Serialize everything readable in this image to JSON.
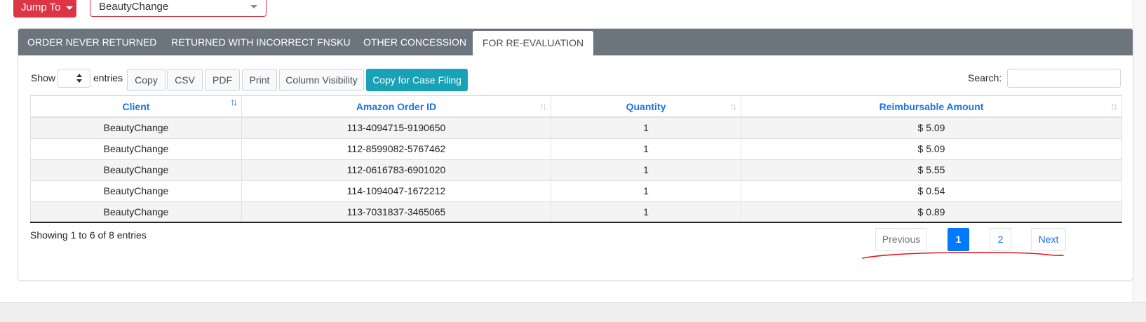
{
  "top": {
    "jump_label": "Jump To",
    "client_value": "BeautyChange"
  },
  "tabs": [
    {
      "label": "ORDER NEVER RETURNED",
      "active": false
    },
    {
      "label": "RETURNED WITH INCORRECT FNSKU",
      "active": false
    },
    {
      "label": "OTHER CONCESSION",
      "active": false
    },
    {
      "label": "FOR RE-EVALUATION",
      "active": true
    }
  ],
  "toolbar": {
    "show_label": "Show",
    "entries_label": "entries",
    "buttons": [
      "Copy",
      "CSV",
      "PDF",
      "Print",
      "Column Visibility"
    ],
    "case_filing_label": "Copy for Case Filing",
    "search_label": "Search:"
  },
  "table": {
    "headers": [
      "Client",
      "Amazon Order ID",
      "Quantity",
      "Reimbursable Amount"
    ],
    "rows": [
      [
        "BeautyChange",
        "113-4094715-9190650",
        "1",
        "$ 5.09"
      ],
      [
        "BeautyChange",
        "112-8599082-5767462",
        "1",
        "$ 5.09"
      ],
      [
        "BeautyChange",
        "112-0616783-6901020",
        "1",
        "$ 5.55"
      ],
      [
        "BeautyChange",
        "114-1094047-1672212",
        "1",
        "$ 0.54"
      ],
      [
        "BeautyChange",
        "113-7031837-3465065",
        "1",
        "$ 0.89"
      ]
    ]
  },
  "footer": {
    "info": "Showing 1 to 6 of 8 entries",
    "previous": "Previous",
    "pages": [
      "1",
      "2"
    ],
    "current_page": "1",
    "next": "Next"
  },
  "colors": {
    "accent_red": "#dc3545",
    "tab_bar": "#6c757d",
    "header_link": "#1a73e8",
    "primary_button": "#17a2b8",
    "active_page": "#007bff",
    "annotation": "#e8141b"
  }
}
